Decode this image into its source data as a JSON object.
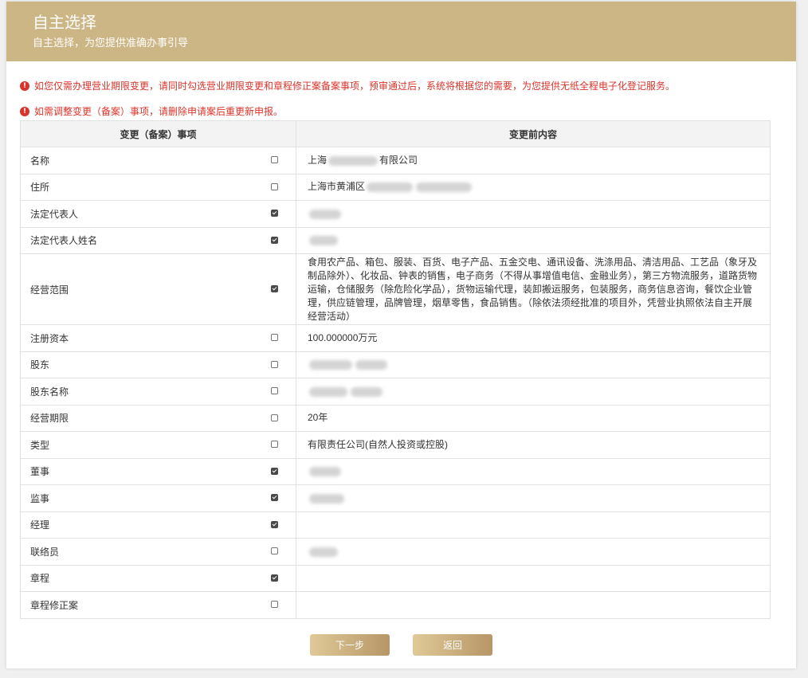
{
  "header": {
    "title": "自主选择",
    "subtitle": "自主选择，为您提供准确办事引导"
  },
  "notices": [
    "如您仅需办理营业期限变更，请同时勾选营业期限变更和章程修正案备案事项，预审通过后，系统将根据您的需要，为您提供无纸全程电子化登记服务。",
    "如需调整变更（备案）事项，请删除申请案后重更新申报。"
  ],
  "table": {
    "headers": [
      "变更（备案）事项",
      "变更前内容"
    ],
    "rows": [
      {
        "item": "名称",
        "checked": false,
        "value": "上海",
        "value_after": "有限公司",
        "redacted": true
      },
      {
        "item": "住所",
        "checked": false,
        "value": "上海市黄浦区",
        "value_after": "",
        "redacted": true
      },
      {
        "item": "法定代表人",
        "checked": true,
        "value": "",
        "value_after": "",
        "redacted": true
      },
      {
        "item": "法定代表人姓名",
        "checked": true,
        "value": "",
        "value_after": "",
        "redacted": true
      },
      {
        "item": "经营范围",
        "checked": true,
        "value": "食用农产品、箱包、服装、百货、电子产品、五金交电、通讯设备、洗涤用品、清洁用品、工艺品（象牙及制品除外）、化妆品、钟表的销售，电子商务（不得从事增值电信、金融业务），第三方物流服务，道路货物运输，仓储服务（除危险化学品），货物运输代理，装卸搬运服务，包装服务，商务信息咨询，餐饮企业管理，供应链管理，品牌管理，烟草零售，食品销售。（除依法须经批准的项目外，凭营业执照依法自主开展经营活动）",
        "value_after": "",
        "redacted": false
      },
      {
        "item": "注册资本",
        "checked": false,
        "value": "100.000000万元",
        "value_after": "",
        "redacted": false
      },
      {
        "item": "股东",
        "checked": false,
        "value": "",
        "value_after": "",
        "redacted": true
      },
      {
        "item": "股东名称",
        "checked": false,
        "value": "",
        "value_after": "",
        "redacted": true
      },
      {
        "item": "经营期限",
        "checked": false,
        "value": "20年",
        "value_after": "",
        "redacted": false
      },
      {
        "item": "类型",
        "checked": false,
        "value": "有限责任公司(自然人投资或控股)",
        "value_after": "",
        "redacted": false
      },
      {
        "item": "董事",
        "checked": true,
        "value": "",
        "value_after": "",
        "redacted": true
      },
      {
        "item": "监事",
        "checked": true,
        "value": "",
        "value_after": "",
        "redacted": true
      },
      {
        "item": "经理",
        "checked": true,
        "value": "",
        "value_after": "",
        "redacted": false
      },
      {
        "item": "联络员",
        "checked": false,
        "value": "",
        "value_after": "",
        "redacted": true
      },
      {
        "item": "章程",
        "checked": true,
        "value": "",
        "value_after": "",
        "redacted": false
      },
      {
        "item": "章程修正案",
        "checked": false,
        "value": "",
        "value_after": "",
        "redacted": false
      }
    ]
  },
  "buttons": {
    "next": "下一步",
    "back": "返回"
  },
  "colors": {
    "header_bg": "#cdb685",
    "notice_red": "#d9342b",
    "button_gold_light": "#e0c998",
    "button_gold_dark": "#b79667"
  }
}
